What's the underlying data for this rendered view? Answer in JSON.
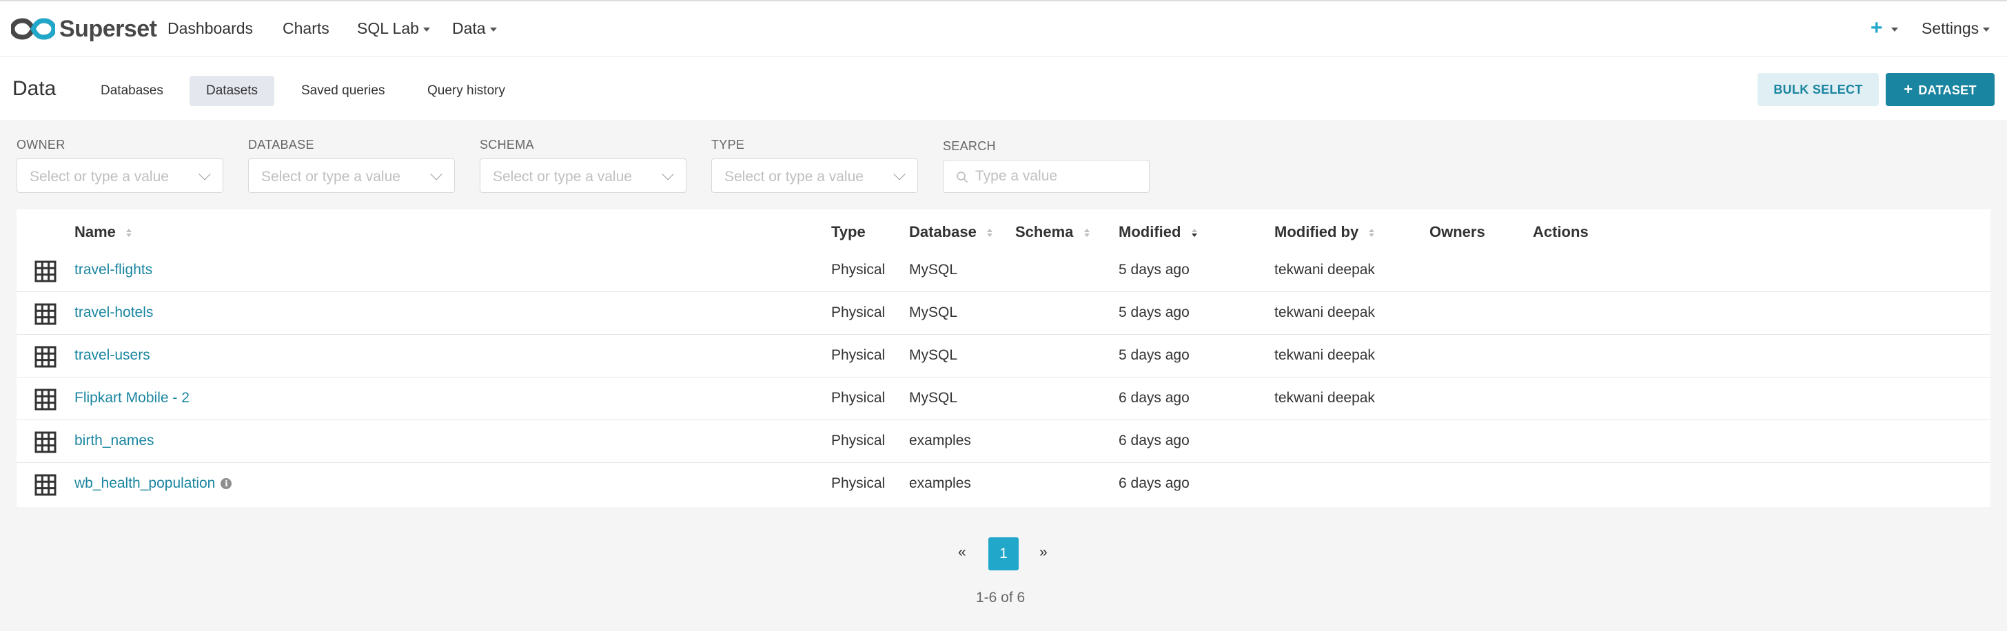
{
  "brand": {
    "name": "Superset"
  },
  "nav": {
    "dashboards": "Dashboards",
    "charts": "Charts",
    "sql_lab": "SQL Lab",
    "data": "Data",
    "new": "+",
    "settings": "Settings"
  },
  "subheader": {
    "title": "Data",
    "tabs": [
      "Databases",
      "Datasets",
      "Saved queries",
      "Query history"
    ],
    "active_tab": "Datasets",
    "bulk_select": "BULK SELECT",
    "add_dataset": "DATASET"
  },
  "filters": {
    "owner": {
      "label": "OWNER",
      "placeholder": "Select or type a value"
    },
    "database": {
      "label": "DATABASE",
      "placeholder": "Select or type a value"
    },
    "schema": {
      "label": "SCHEMA",
      "placeholder": "Select or type a value"
    },
    "type": {
      "label": "TYPE",
      "placeholder": "Select or type a value"
    },
    "search": {
      "label": "SEARCH",
      "placeholder": "Type a value"
    }
  },
  "table": {
    "headers": {
      "name": "Name",
      "type": "Type",
      "database": "Database",
      "schema": "Schema",
      "modified": "Modified",
      "modified_by": "Modified by",
      "owners": "Owners",
      "actions": "Actions"
    },
    "rows": [
      {
        "name": "travel-flights",
        "type": "Physical",
        "database": "MySQL",
        "schema": "",
        "modified": "5 days ago",
        "modified_by": "tekwani deepak",
        "owners": ""
      },
      {
        "name": "travel-hotels",
        "type": "Physical",
        "database": "MySQL",
        "schema": "",
        "modified": "5 days ago",
        "modified_by": "tekwani deepak",
        "owners": ""
      },
      {
        "name": "travel-users",
        "type": "Physical",
        "database": "MySQL",
        "schema": "",
        "modified": "5 days ago",
        "modified_by": "tekwani deepak",
        "owners": ""
      },
      {
        "name": "Flipkart Mobile - 2",
        "type": "Physical",
        "database": "MySQL",
        "schema": "",
        "modified": "6 days ago",
        "modified_by": "tekwani deepak",
        "owners": ""
      },
      {
        "name": "birth_names",
        "type": "Physical",
        "database": "examples",
        "schema": "",
        "modified": "6 days ago",
        "modified_by": "",
        "owners": ""
      },
      {
        "name": "wb_health_population",
        "type": "Physical",
        "database": "examples",
        "schema": "",
        "modified": "6 days ago",
        "modified_by": "",
        "owners": "",
        "info": "i"
      }
    ]
  },
  "pagination": {
    "prev": "«",
    "current": "1",
    "next": "»",
    "summary": "1-6 of 6"
  },
  "colors": {
    "link": "#1a85a0",
    "primary": "#20a7c9",
    "primary_dark": "#1a85a0"
  },
  "icons": {
    "brand": "superset-logo-icon",
    "dataset_row": "table-grid-icon",
    "search": "search-icon",
    "sort": "sort-icon",
    "sort_desc": "sort-desc-icon",
    "info": "info-icon"
  }
}
